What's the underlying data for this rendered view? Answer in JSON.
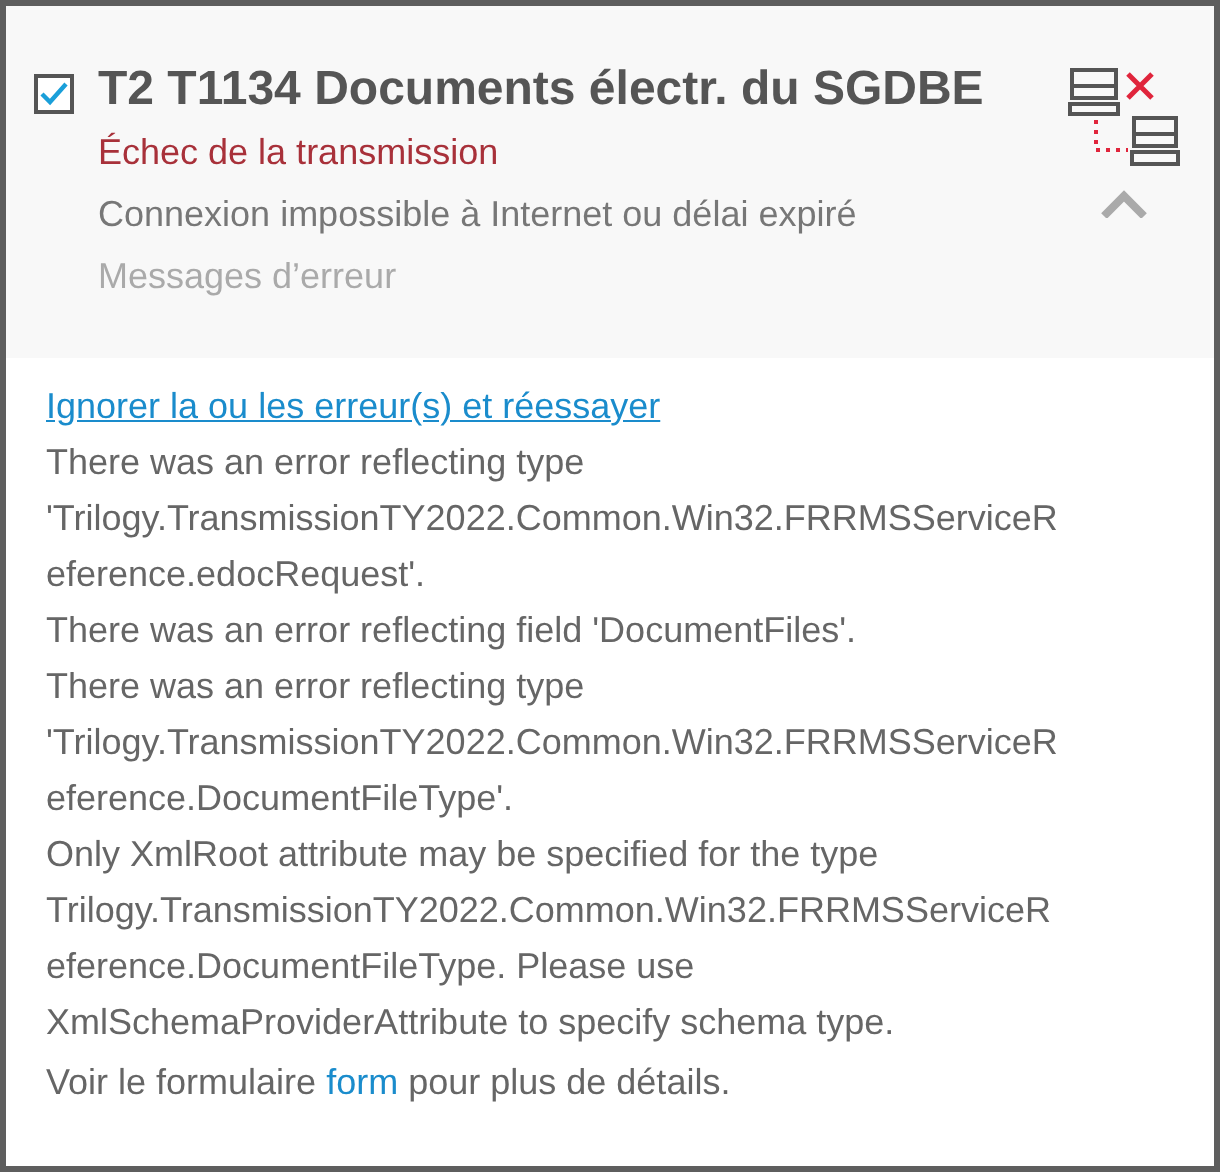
{
  "item": {
    "checked": true,
    "title": "T2 T1134 Documents électr. du SGDBE",
    "status": "Échec de la transmission",
    "detail": "Connexion impossible à Internet ou délai expiré",
    "messages_label": "Messages d’erreur",
    "expanded": true
  },
  "errors": {
    "retry_link": "Ignorer la ou les erreur(s) et réessayer",
    "lines": [
      "There was an error reflecting type",
      "'Trilogy.TransmissionTY2022.Common.Win32.FRRMSServiceR",
      "eference.edocRequest'.",
      "There was an error reflecting field 'DocumentFiles'.",
      "There was an error reflecting type",
      "'Trilogy.TransmissionTY2022.Common.Win32.FRRMSServiceR",
      "eference.DocumentFileType'.",
      "Only XmlRoot attribute may be specified for the type",
      "Trilogy.TransmissionTY2022.Common.Win32.FRRMSServiceR",
      "eference.DocumentFileType. Please use",
      "XmlSchemaProviderAttribute to specify schema type."
    ],
    "footer": {
      "before": "Voir le formulaire",
      "link": "form",
      "after": "pour plus de détails."
    }
  }
}
